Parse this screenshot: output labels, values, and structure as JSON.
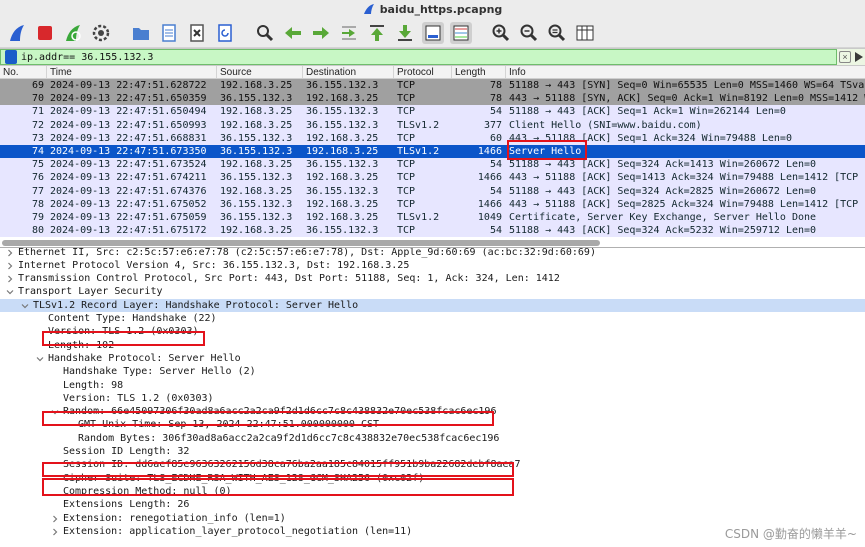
{
  "window": {
    "title": "baidu_https.pcapng"
  },
  "toolbar": {
    "buttons": [
      {
        "name": "start-capture-icon",
        "color": "#2a5fd1"
      },
      {
        "name": "stop-capture-icon",
        "color": "#d8282c"
      },
      {
        "name": "restart-capture-icon",
        "color": "#3aa83a"
      },
      {
        "name": "capture-options-icon",
        "color": "#444444"
      },
      {
        "name": "open-file-icon",
        "color": "#4a7fd0"
      },
      {
        "name": "save-file-icon",
        "color": "#4a7fd0"
      },
      {
        "name": "close-file-icon",
        "color": "#555555"
      },
      {
        "name": "reload-file-icon",
        "color": "#2a5fd1"
      },
      {
        "name": "find-packet-icon",
        "color": "#333333"
      },
      {
        "name": "go-back-icon",
        "color": "#59a838"
      },
      {
        "name": "go-forward-icon",
        "color": "#59a838"
      },
      {
        "name": "go-to-packet-icon",
        "color": "#59a838"
      },
      {
        "name": "go-first-packet-icon",
        "color": "#59a838"
      },
      {
        "name": "go-last-packet-icon",
        "color": "#59a838"
      },
      {
        "name": "autoscroll-icon",
        "color": "#3a3a3a"
      },
      {
        "name": "colorize-icon",
        "color": "#3a3a3a"
      },
      {
        "name": "zoom-in-icon",
        "color": "#333333"
      },
      {
        "name": "zoom-out-icon",
        "color": "#333333"
      },
      {
        "name": "normal-size-icon",
        "color": "#333333"
      },
      {
        "name": "resize-columns-icon",
        "color": "#333333"
      }
    ]
  },
  "filter": {
    "value": "ip.addr== 36.155.132.3"
  },
  "columns": [
    "No.",
    "Time",
    "Source",
    "Destination",
    "Protocol",
    "Length",
    "Info"
  ],
  "packets": [
    {
      "no": "69",
      "time": "2024-09-13 22:47:51.628722",
      "src": "192.168.3.25",
      "dst": "36.155.132.3",
      "proto": "TCP",
      "len": "78",
      "info": "51188 → 443 [SYN] Seq=0 Win=65535 Len=0 MSS=1460 WS=64 TSval=",
      "style": "row-syn"
    },
    {
      "no": "70",
      "time": "2024-09-13 22:47:51.650359",
      "src": "36.155.132.3",
      "dst": "192.168.3.25",
      "proto": "TCP",
      "len": "78",
      "info": "443 → 51188 [SYN, ACK] Seq=0 Ack=1 Win=8192 Len=0 MSS=1412 WS",
      "style": "row-syn"
    },
    {
      "no": "71",
      "time": "2024-09-13 22:47:51.650494",
      "src": "192.168.3.25",
      "dst": "36.155.132.3",
      "proto": "TCP",
      "len": "54",
      "info": "51188 → 443 [ACK] Seq=1 Ack=1 Win=262144 Len=0",
      "style": "row-tcp"
    },
    {
      "no": "72",
      "time": "2024-09-13 22:47:51.650993",
      "src": "192.168.3.25",
      "dst": "36.155.132.3",
      "proto": "TLSv1.2",
      "len": "377",
      "info": "Client Hello (SNI=www.baidu.com)",
      "style": "row-tcp"
    },
    {
      "no": "73",
      "time": "2024-09-13 22:47:51.668831",
      "src": "36.155.132.3",
      "dst": "192.168.3.25",
      "proto": "TCP",
      "len": "60",
      "info": "443 → 51188 [ACK] Seq=1 Ack=324 Win=79488 Len=0",
      "style": "row-tcp"
    },
    {
      "no": "74",
      "time": "2024-09-13 22:47:51.673350",
      "src": "36.155.132.3",
      "dst": "192.168.3.25",
      "proto": "TLSv1.2",
      "len": "1466",
      "info": "Server Hello",
      "style": "row-sel"
    },
    {
      "no": "75",
      "time": "2024-09-13 22:47:51.673524",
      "src": "192.168.3.25",
      "dst": "36.155.132.3",
      "proto": "TCP",
      "len": "54",
      "info": "51188 → 443 [ACK] Seq=324 Ack=1413 Win=260672 Len=0",
      "style": "row-tcp"
    },
    {
      "no": "76",
      "time": "2024-09-13 22:47:51.674211",
      "src": "36.155.132.3",
      "dst": "192.168.3.25",
      "proto": "TCP",
      "len": "1466",
      "info": "443 → 51188 [ACK] Seq=1413 Ack=324 Win=79488 Len=1412 [TCP PD",
      "style": "row-tcp"
    },
    {
      "no": "77",
      "time": "2024-09-13 22:47:51.674376",
      "src": "192.168.3.25",
      "dst": "36.155.132.3",
      "proto": "TCP",
      "len": "54",
      "info": "51188 → 443 [ACK] Seq=324 Ack=2825 Win=260672 Len=0",
      "style": "row-tcp"
    },
    {
      "no": "78",
      "time": "2024-09-13 22:47:51.675052",
      "src": "36.155.132.3",
      "dst": "192.168.3.25",
      "proto": "TCP",
      "len": "1466",
      "info": "443 → 51188 [ACK] Seq=2825 Ack=324 Win=79488 Len=1412 [TCP PD",
      "style": "row-tcp"
    },
    {
      "no": "79",
      "time": "2024-09-13 22:47:51.675059",
      "src": "36.155.132.3",
      "dst": "192.168.3.25",
      "proto": "TLSv1.2",
      "len": "1049",
      "info": "Certificate, Server Key Exchange, Server Hello Done",
      "style": "row-tcp"
    },
    {
      "no": "80",
      "time": "2024-09-13 22:47:51.675172",
      "src": "192.168.3.25",
      "dst": "36.155.132.3",
      "proto": "TCP",
      "len": "54",
      "info": "51188 → 443 [ACK] Seq=324 Ack=5232 Win=259712 Len=0",
      "style": "row-tcp"
    }
  ],
  "details": [
    {
      "name": "detail-ethernet",
      "level": 0,
      "tw": "right",
      "text": "Ethernet II, Src: c2:5c:57:e6:e7:78 (c2:5c:57:e6:e7:78), Dst: Apple_9d:60:69 (ac:bc:32:9d:60:69)"
    },
    {
      "name": "detail-ip",
      "level": 0,
      "tw": "right",
      "text": "Internet Protocol Version 4, Src: 36.155.132.3, Dst: 192.168.3.25"
    },
    {
      "name": "detail-tcp",
      "level": 0,
      "tw": "right",
      "text": "Transmission Control Protocol, Src Port: 443, Dst Port: 51188, Seq: 1, Ack: 324, Len: 1412"
    },
    {
      "name": "detail-tls",
      "level": 0,
      "tw": "down",
      "text": "Transport Layer Security"
    },
    {
      "name": "detail-tls-record",
      "level": 1,
      "tw": "down",
      "text": "TLSv1.2 Record Layer: Handshake Protocol: Server Hello",
      "selected": true
    },
    {
      "name": "detail-content-type",
      "level": 2,
      "tw": "",
      "text": "Content Type: Handshake (22)"
    },
    {
      "name": "detail-version",
      "level": 2,
      "tw": "",
      "text": "Version: TLS 1.2 (0x0303)"
    },
    {
      "name": "detail-length",
      "level": 2,
      "tw": "",
      "text": "Length: 102"
    },
    {
      "name": "detail-handshake",
      "level": 2,
      "tw": "down",
      "text": "Handshake Protocol: Server Hello"
    },
    {
      "name": "detail-handshake-type",
      "level": 3,
      "tw": "",
      "text": "Handshake Type: Server Hello (2)"
    },
    {
      "name": "detail-hs-length",
      "level": 3,
      "tw": "",
      "text": "Length: 98"
    },
    {
      "name": "detail-hs-version",
      "level": 3,
      "tw": "",
      "text": "Version: TLS 1.2 (0x0303)"
    },
    {
      "name": "detail-random",
      "level": 3,
      "tw": "down",
      "text": "Random: 66e45097306f30ad8a6acc2a2ca9f2d1d6cc7c8c438832e70ec538fcac6ec196"
    },
    {
      "name": "detail-gmt-time",
      "level": 4,
      "tw": "",
      "text": "GMT Unix Time: Sep 13, 2024 22:47:51.000000000 CST"
    },
    {
      "name": "detail-random-bytes",
      "level": 4,
      "tw": "",
      "text": "Random Bytes: 306f30ad8a6acc2a2ca9f2d1d6cc7c8c438832e70ec538fcac6ec196"
    },
    {
      "name": "detail-session-id-length",
      "level": 3,
      "tw": "",
      "text": "Session ID Length: 32"
    },
    {
      "name": "detail-session-id",
      "level": 3,
      "tw": "",
      "text": "Session ID: dd6aef85e96363262156d38ca76ba2aa185c84015ff951b9ba22682debf8aea7"
    },
    {
      "name": "detail-cipher-suite",
      "level": 3,
      "tw": "",
      "text": "Cipher Suite: TLS_ECDHE_RSA_WITH_AES_128_GCM_SHA256 (0xc02f)"
    },
    {
      "name": "detail-compression",
      "level": 3,
      "tw": "",
      "text": "Compression Method: null (0)"
    },
    {
      "name": "detail-ext-length",
      "level": 3,
      "tw": "",
      "text": "Extensions Length: 26"
    },
    {
      "name": "detail-ext-reneg",
      "level": 3,
      "tw": "right",
      "text": "Extension: renegotiation_info (len=1)"
    },
    {
      "name": "detail-ext-alpn",
      "level": 3,
      "tw": "right",
      "text": "Extension: application_layer_protocol_negotiation (len=11)"
    }
  ],
  "watermark": "CSDN @勤奋的懒羊羊~"
}
